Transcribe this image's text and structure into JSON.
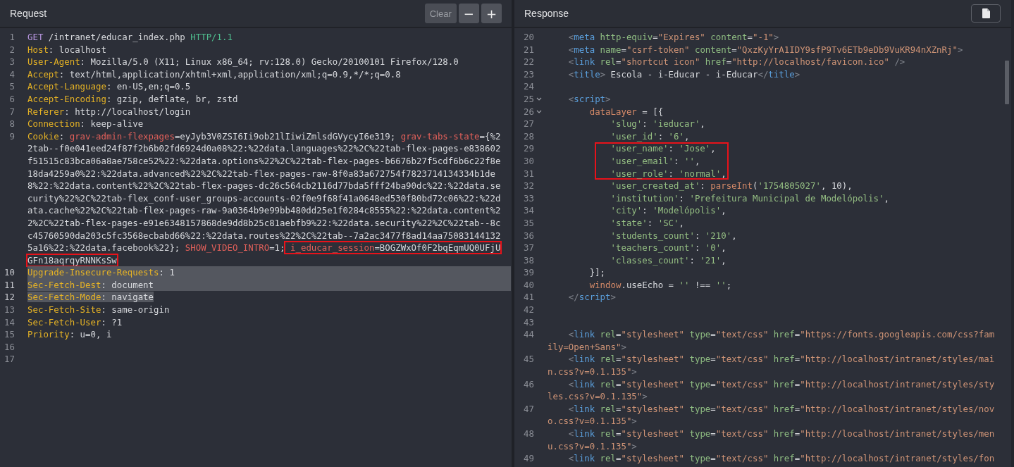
{
  "request": {
    "title": "Request",
    "buttons": [
      {
        "label": "Clear",
        "disabled": true
      },
      {
        "label": "−",
        "disabled": false
      },
      {
        "label": "+",
        "disabled": false
      }
    ],
    "lines": [
      {
        "number": "1",
        "highlighted": false,
        "tokens": [
          {
            "kind": "method",
            "text": "GET"
          },
          {
            "kind": "text",
            "text": " /intranet/educar_index.php "
          },
          {
            "kind": "version",
            "text": "HTTP/1.1"
          }
        ]
      },
      {
        "number": "2",
        "highlighted": false,
        "tokens": [
          {
            "kind": "key",
            "text": "Host"
          },
          {
            "kind": "text",
            "text": ": localhost"
          }
        ]
      },
      {
        "number": "3",
        "highlighted": false,
        "tokens": [
          {
            "kind": "key",
            "text": "User-Agent"
          },
          {
            "kind": "text",
            "text": ": Mozilla/5.0 (X11; Linux x86_64; rv:128.0) Gecko/20100101 Firefox/128.0"
          }
        ]
      },
      {
        "number": "4",
        "highlighted": false,
        "tokens": [
          {
            "kind": "key",
            "text": "Accept"
          },
          {
            "kind": "text",
            "text": ": text/html,application/xhtml+xml,application/xml;q=0.9,*/*;q=0.8"
          }
        ]
      },
      {
        "number": "5",
        "highlighted": false,
        "tokens": [
          {
            "kind": "key",
            "text": "Accept-Language"
          },
          {
            "kind": "text",
            "text": ": en-US,en;q=0.5"
          }
        ]
      },
      {
        "number": "6",
        "highlighted": false,
        "tokens": [
          {
            "kind": "key",
            "text": "Accept-Encoding"
          },
          {
            "kind": "text",
            "text": ": gzip, deflate, br, zstd"
          }
        ]
      },
      {
        "number": "7",
        "highlighted": false,
        "tokens": [
          {
            "kind": "key",
            "text": "Referer"
          },
          {
            "kind": "text",
            "text": ": http://localhost/login"
          }
        ]
      },
      {
        "number": "8",
        "highlighted": false,
        "tokens": [
          {
            "kind": "key",
            "text": "Connection"
          },
          {
            "kind": "text",
            "text": ": keep-alive"
          }
        ]
      },
      {
        "number": "9",
        "highlighted": false,
        "segments": [
          {
            "marked": false,
            "tokens": [
              {
                "kind": "key",
                "text": "Cookie"
              },
              {
                "kind": "text",
                "text": ": "
              },
              {
                "kind": "cookie",
                "text": "grav-admin-flexpages"
              },
              {
                "kind": "text",
                "text": "=eyJyb3V0ZSI6Ii9ob21lIiwiZmlsdGVycyI6e319; "
              },
              {
                "kind": "cookie",
                "text": "grav-tabs-state"
              },
              {
                "kind": "text",
                "text": "={%22tab--f0e041eed24f87f2b6b02fd6924d0a08%22:%22data.languages%22%2C%22tab-flex-pages-e838602f51515c83bca06a8ae758ce52%22:%22data.options%22%2C%22tab-flex-pages-b6676b27f5cdf6b6c22f8e18da4259a0%22:%22data.advanced%22%2C%22tab-flex-pages-raw-8f0a83a672754f7823714134334b1de8%22:%22data.content%22%2C%22tab-flex-pages-dc26c564cb2116d77bda5fff24ba90dc%22:%22data.security%22%2C%22tab-flex_conf-user_groups-accounts-02f0e9f68f41a0648ed530f80bd72c06%22:%22data.cache%22%2C%22tab-flex-pages-raw-9a0364b9e99bb480dd25e1f0284c8555%22:%22data.content%22%2C%22tab-flex-pages-e91e6348157868de9dd8b25c81aebfb9%22:%22data.security%22%2C%22tab--8cc45760590da203c5fc3568ecbabd66%22:%22data.routes%22%2C%22tab--7a2ac3477f8ad14aa75083144132"
              }
            ]
          },
          {
            "marked": false,
            "tokens": [
              {
                "kind": "text",
                "text": "5a16%22:%22data.facebook%22}; "
              },
              {
                "kind": "cookie",
                "text": "SHOW_VIDEO_INTRO"
              },
              {
                "kind": "text",
                "text": "=1;"
              }
            ]
          },
          {
            "marked": true,
            "tokens": [
              {
                "kind": "cookie",
                "text": " i_educar_session"
              },
              {
                "kind": "text",
                "text": "=BOGZWxOf0F2bqEqmUQ0UFjU"
              }
            ]
          },
          {
            "marked": true,
            "tokens": [
              {
                "kind": "text",
                "text": "GFn18aqrqyRNNKsSw"
              }
            ]
          }
        ]
      },
      {
        "number": "10",
        "highlighted": true,
        "tokens": [
          {
            "kind": "key",
            "text": "Upgrade-Insecure-Requests"
          },
          {
            "kind": "text",
            "text": ": 1"
          }
        ]
      },
      {
        "number": "11",
        "highlighted": true,
        "tokens": [
          {
            "kind": "key",
            "text": "Sec-Fetch-Dest"
          },
          {
            "kind": "text",
            "text": ": document"
          }
        ]
      },
      {
        "number": "12",
        "highlighted": true,
        "tokens": [
          {
            "kind": "key",
            "text": "Sec-Fetch-Mode"
          },
          {
            "kind": "text",
            "text": ": navigate"
          }
        ]
      },
      {
        "number": "13",
        "highlighted": false,
        "tokens": [
          {
            "kind": "key",
            "text": "Sec-Fetch-Site"
          },
          {
            "kind": "text",
            "text": ": same-origin"
          }
        ]
      },
      {
        "number": "14",
        "highlighted": false,
        "tokens": [
          {
            "kind": "key",
            "text": "Sec-Fetch-User"
          },
          {
            "kind": "text",
            "text": ": ?1"
          }
        ]
      },
      {
        "number": "15",
        "highlighted": false,
        "tokens": [
          {
            "kind": "key",
            "text": "Priority"
          },
          {
            "kind": "text",
            "text": ": u=0, i"
          }
        ]
      },
      {
        "number": "16",
        "highlighted": false
      },
      {
        "number": "17",
        "highlighted": false
      }
    ]
  },
  "response": {
    "title": "Response",
    "lines": [
      {
        "number": "20",
        "tokens": [
          {
            "kind": "bracket",
            "text": "    <"
          },
          {
            "kind": "tag",
            "text": "meta"
          },
          {
            "kind": "attr",
            "text": " http-equiv"
          },
          {
            "kind": "text",
            "text": "="
          },
          {
            "kind": "str",
            "text": "\"Expires\""
          },
          {
            "kind": "attr",
            "text": " content"
          },
          {
            "kind": "text",
            "text": "="
          },
          {
            "kind": "str",
            "text": "\"-1\""
          },
          {
            "kind": "bracket",
            "text": ">"
          }
        ]
      },
      {
        "number": "21",
        "tokens": [
          {
            "kind": "bracket",
            "text": "    <"
          },
          {
            "kind": "tag",
            "text": "meta"
          },
          {
            "kind": "attr",
            "text": " name"
          },
          {
            "kind": "text",
            "text": "="
          },
          {
            "kind": "str",
            "text": "\"csrf-token\""
          },
          {
            "kind": "attr",
            "text": " content"
          },
          {
            "kind": "text",
            "text": "="
          },
          {
            "kind": "str",
            "text": "\"QxzKyYrA1IDY9sfP9Tv6ETb9eDb9VuKR94nXZnRj\""
          },
          {
            "kind": "bracket",
            "text": ">"
          }
        ]
      },
      {
        "number": "22",
        "tokens": [
          {
            "kind": "bracket",
            "text": "    <"
          },
          {
            "kind": "tag",
            "text": "link"
          },
          {
            "kind": "attr",
            "text": " rel"
          },
          {
            "kind": "text",
            "text": "="
          },
          {
            "kind": "str",
            "text": "\"shortcut icon\""
          },
          {
            "kind": "attr",
            "text": " href"
          },
          {
            "kind": "text",
            "text": "="
          },
          {
            "kind": "str",
            "text": "\"http://localhost/favicon.ico\""
          },
          {
            "kind": "bracket",
            "text": " />"
          }
        ]
      },
      {
        "number": "23",
        "tokens": [
          {
            "kind": "bracket",
            "text": "    <"
          },
          {
            "kind": "tag",
            "text": "title"
          },
          {
            "kind": "bracket",
            "text": ">"
          },
          {
            "kind": "text",
            "text": " Escola - i-Educar - i-Educar"
          },
          {
            "kind": "bracket",
            "text": "</"
          },
          {
            "kind": "tag",
            "text": "title"
          },
          {
            "kind": "bracket",
            "text": ">"
          }
        ]
      },
      {
        "number": "24"
      },
      {
        "number": "25",
        "foldable": true,
        "tokens": [
          {
            "kind": "bracket",
            "text": "    <"
          },
          {
            "kind": "tag",
            "text": "script"
          },
          {
            "kind": "bracket",
            "text": ">"
          }
        ]
      },
      {
        "number": "26",
        "foldable": true,
        "tokens": [
          {
            "kind": "ident",
            "text": "        dataLayer"
          },
          {
            "kind": "text",
            "text": " = [{"
          }
        ]
      },
      {
        "number": "27",
        "tokens": [
          {
            "kind": "jsstr",
            "text": "            'slug'"
          },
          {
            "kind": "text",
            "text": ": "
          },
          {
            "kind": "jsstr",
            "text": "'ieducar'"
          },
          {
            "kind": "text",
            "text": ","
          }
        ]
      },
      {
        "number": "28",
        "tokens": [
          {
            "kind": "jsstr",
            "text": "            'user_id'"
          },
          {
            "kind": "text",
            "text": ": "
          },
          {
            "kind": "jsstr",
            "text": "'6'"
          },
          {
            "kind": "text",
            "text": ","
          }
        ]
      },
      {
        "number": "29",
        "boxed": true,
        "tokens": [
          {
            "kind": "jsstr",
            "text": "   'user_name'"
          },
          {
            "kind": "text",
            "text": ": "
          },
          {
            "kind": "jsstr",
            "text": "'Jose'"
          },
          {
            "kind": "text",
            "text": ","
          }
        ]
      },
      {
        "number": "30",
        "boxed": true,
        "tokens": [
          {
            "kind": "jsstr",
            "text": "   'user_email'"
          },
          {
            "kind": "text",
            "text": ": "
          },
          {
            "kind": "jsstr",
            "text": "''"
          },
          {
            "kind": "text",
            "text": ","
          }
        ]
      },
      {
        "number": "31",
        "boxed": true,
        "tokens": [
          {
            "kind": "jsstr",
            "text": "   'user_role'"
          },
          {
            "kind": "text",
            "text": ": "
          },
          {
            "kind": "jsstr",
            "text": "'normal'"
          },
          {
            "kind": "text",
            "text": ","
          }
        ]
      },
      {
        "number": "32",
        "tokens": [
          {
            "kind": "jsstr",
            "text": "            'user_created_at'"
          },
          {
            "kind": "text",
            "text": ": "
          },
          {
            "kind": "ident",
            "text": "parseInt"
          },
          {
            "kind": "text",
            "text": "("
          },
          {
            "kind": "jsstr",
            "text": "'1754805027'"
          },
          {
            "kind": "text",
            "text": ", 10),"
          }
        ]
      },
      {
        "number": "33",
        "tokens": [
          {
            "kind": "jsstr",
            "text": "            'institution'"
          },
          {
            "kind": "text",
            "text": ": "
          },
          {
            "kind": "jsstr",
            "text": "'Prefeitura Municipal de Modelópolis'"
          },
          {
            "kind": "text",
            "text": ","
          }
        ]
      },
      {
        "number": "34",
        "tokens": [
          {
            "kind": "jsstr",
            "text": "            'city'"
          },
          {
            "kind": "text",
            "text": ": "
          },
          {
            "kind": "jsstr",
            "text": "'Modelópolis'"
          },
          {
            "kind": "text",
            "text": ","
          }
        ]
      },
      {
        "number": "35",
        "tokens": [
          {
            "kind": "jsstr",
            "text": "            'state'"
          },
          {
            "kind": "text",
            "text": ": "
          },
          {
            "kind": "jsstr",
            "text": "'SC'"
          },
          {
            "kind": "text",
            "text": ","
          }
        ]
      },
      {
        "number": "36",
        "tokens": [
          {
            "kind": "jsstr",
            "text": "            'students_count'"
          },
          {
            "kind": "text",
            "text": ": "
          },
          {
            "kind": "jsstr",
            "text": "'210'"
          },
          {
            "kind": "text",
            "text": ","
          }
        ]
      },
      {
        "number": "37",
        "tokens": [
          {
            "kind": "jsstr",
            "text": "            'teachers_count'"
          },
          {
            "kind": "text",
            "text": ": "
          },
          {
            "kind": "jsstr",
            "text": "'0'"
          },
          {
            "kind": "text",
            "text": ","
          }
        ]
      },
      {
        "number": "38",
        "tokens": [
          {
            "kind": "jsstr",
            "text": "            'classes_count'"
          },
          {
            "kind": "text",
            "text": ": "
          },
          {
            "kind": "jsstr",
            "text": "'21'"
          },
          {
            "kind": "text",
            "text": ","
          }
        ]
      },
      {
        "number": "39",
        "tokens": [
          {
            "kind": "text",
            "text": "        }];"
          }
        ]
      },
      {
        "number": "40",
        "tokens": [
          {
            "kind": "ident",
            "text": "        window"
          },
          {
            "kind": "text",
            "text": ".useEcho = "
          },
          {
            "kind": "jsstr",
            "text": "''"
          },
          {
            "kind": "text",
            "text": " !== "
          },
          {
            "kind": "jsstr",
            "text": "''"
          },
          {
            "kind": "text",
            "text": ";"
          }
        ]
      },
      {
        "number": "41",
        "tokens": [
          {
            "kind": "bracket",
            "text": "    </"
          },
          {
            "kind": "tag",
            "text": "script"
          },
          {
            "kind": "bracket",
            "text": ">"
          }
        ]
      },
      {
        "number": "42"
      },
      {
        "number": "43"
      },
      {
        "number": "44",
        "tokens": [
          {
            "kind": "bracket",
            "text": "    <"
          },
          {
            "kind": "tag",
            "text": "link"
          },
          {
            "kind": "attr",
            "text": " rel"
          },
          {
            "kind": "text",
            "text": "="
          },
          {
            "kind": "str",
            "text": "\"stylesheet\""
          },
          {
            "kind": "attr",
            "text": " type"
          },
          {
            "kind": "text",
            "text": "="
          },
          {
            "kind": "str",
            "text": "\"text/css\""
          },
          {
            "kind": "attr",
            "text": " href"
          },
          {
            "kind": "text",
            "text": "="
          },
          {
            "kind": "str",
            "text": "\"https://fonts.googleapis.com/css?family=Open+Sans\""
          },
          {
            "kind": "bracket",
            "text": ">"
          }
        ]
      },
      {
        "number": "45",
        "tokens": [
          {
            "kind": "bracket",
            "text": "    <"
          },
          {
            "kind": "tag",
            "text": "link"
          },
          {
            "kind": "attr",
            "text": " rel"
          },
          {
            "kind": "text",
            "text": "="
          },
          {
            "kind": "str",
            "text": "\"stylesheet\""
          },
          {
            "kind": "attr",
            "text": " type"
          },
          {
            "kind": "text",
            "text": "="
          },
          {
            "kind": "str",
            "text": "\"text/css\""
          },
          {
            "kind": "attr",
            "text": " href"
          },
          {
            "kind": "text",
            "text": "="
          },
          {
            "kind": "str",
            "text": "\"http://localhost/intranet/styles/main.css?v=0.1.135\""
          },
          {
            "kind": "bracket",
            "text": ">"
          }
        ]
      },
      {
        "number": "46",
        "tokens": [
          {
            "kind": "bracket",
            "text": "    <"
          },
          {
            "kind": "tag",
            "text": "link"
          },
          {
            "kind": "attr",
            "text": " rel"
          },
          {
            "kind": "text",
            "text": "="
          },
          {
            "kind": "str",
            "text": "\"stylesheet\""
          },
          {
            "kind": "attr",
            "text": " type"
          },
          {
            "kind": "text",
            "text": "="
          },
          {
            "kind": "str",
            "text": "\"text/css\""
          },
          {
            "kind": "attr",
            "text": " href"
          },
          {
            "kind": "text",
            "text": "="
          },
          {
            "kind": "str",
            "text": "\"http://localhost/intranet/styles/styles.css?v=0.1.135\""
          },
          {
            "kind": "bracket",
            "text": ">"
          }
        ]
      },
      {
        "number": "47",
        "tokens": [
          {
            "kind": "bracket",
            "text": "    <"
          },
          {
            "kind": "tag",
            "text": "link"
          },
          {
            "kind": "attr",
            "text": " rel"
          },
          {
            "kind": "text",
            "text": "="
          },
          {
            "kind": "str",
            "text": "\"stylesheet\""
          },
          {
            "kind": "attr",
            "text": " type"
          },
          {
            "kind": "text",
            "text": "="
          },
          {
            "kind": "str",
            "text": "\"text/css\""
          },
          {
            "kind": "attr",
            "text": " href"
          },
          {
            "kind": "text",
            "text": "="
          },
          {
            "kind": "str",
            "text": "\"http://localhost/intranet/styles/novo.css?v=0.1.135\""
          },
          {
            "kind": "bracket",
            "text": ">"
          }
        ]
      },
      {
        "number": "48",
        "tokens": [
          {
            "kind": "bracket",
            "text": "    <"
          },
          {
            "kind": "tag",
            "text": "link"
          },
          {
            "kind": "attr",
            "text": " rel"
          },
          {
            "kind": "text",
            "text": "="
          },
          {
            "kind": "str",
            "text": "\"stylesheet\""
          },
          {
            "kind": "attr",
            "text": " type"
          },
          {
            "kind": "text",
            "text": "="
          },
          {
            "kind": "str",
            "text": "\"text/css\""
          },
          {
            "kind": "attr",
            "text": " href"
          },
          {
            "kind": "text",
            "text": "="
          },
          {
            "kind": "str",
            "text": "\"http://localhost/intranet/styles/menu.css?v=0.1.135\""
          },
          {
            "kind": "bracket",
            "text": ">"
          }
        ]
      },
      {
        "number": "49",
        "tokens": [
          {
            "kind": "bracket",
            "text": "    <"
          },
          {
            "kind": "tag",
            "text": "link"
          },
          {
            "kind": "attr",
            "text": " rel"
          },
          {
            "kind": "text",
            "text": "="
          },
          {
            "kind": "str",
            "text": "\"stylesheet\""
          },
          {
            "kind": "attr",
            "text": " type"
          },
          {
            "kind": "text",
            "text": "="
          },
          {
            "kind": "str",
            "text": "\"text/css\""
          },
          {
            "kind": "attr",
            "text": " href"
          },
          {
            "kind": "text",
            "text": "="
          },
          {
            "kind": "str",
            "text": "\"http://localhost/intranet/styles/fon"
          }
        ]
      }
    ]
  }
}
